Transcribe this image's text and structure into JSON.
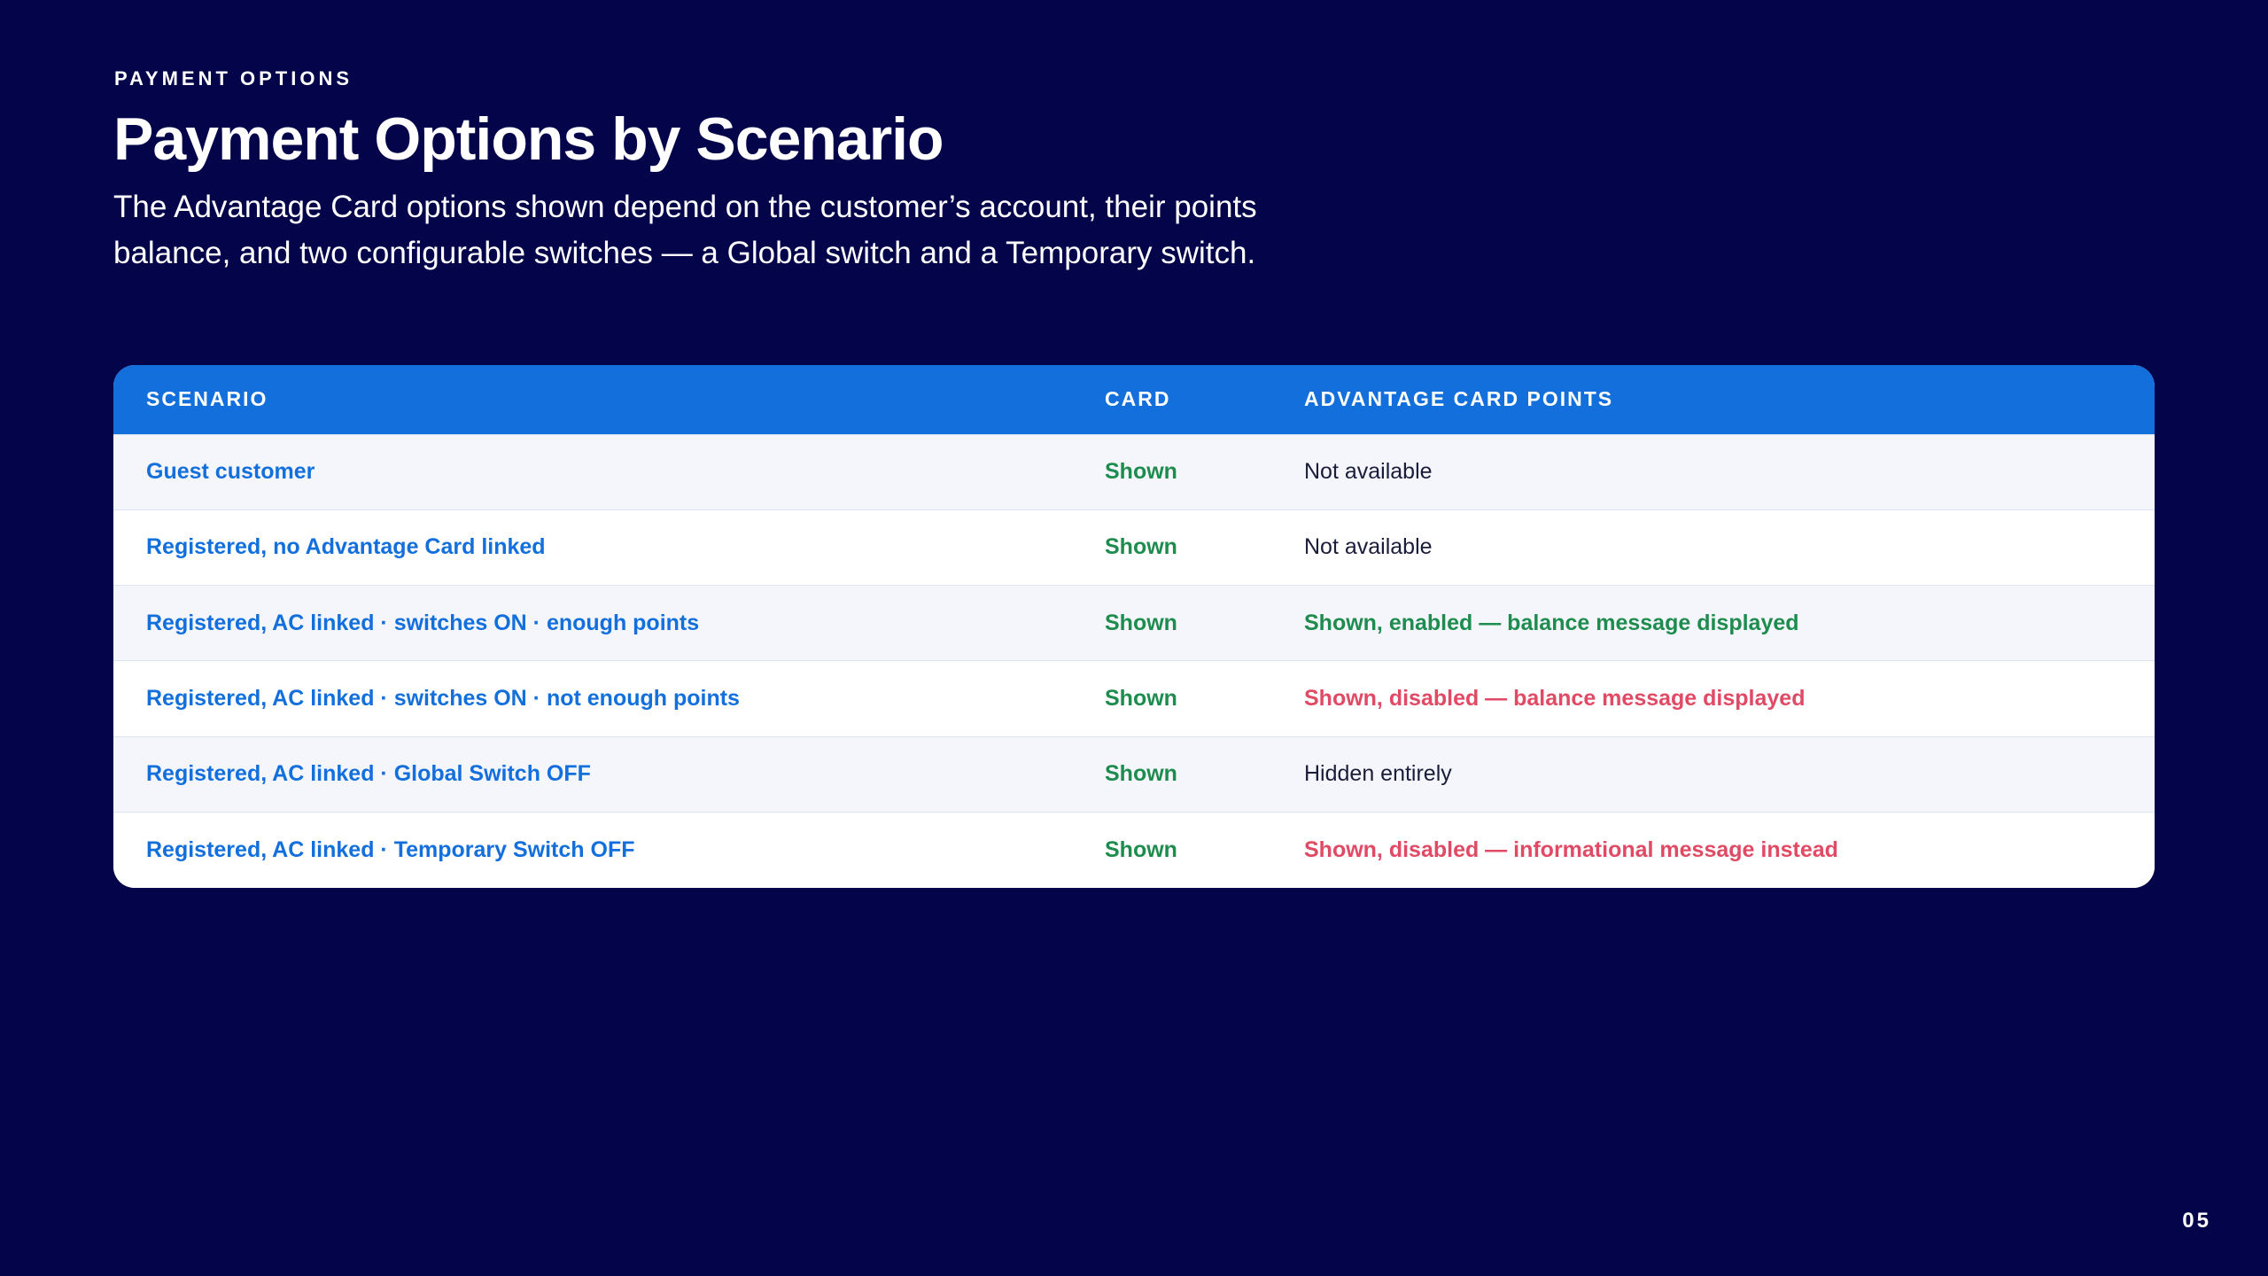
{
  "header": {
    "eyebrow": "PAYMENT OPTIONS",
    "title": "Payment Options by Scenario",
    "subtitle": "The Advantage Card options shown depend on the customer’s account, their points balance, and two configurable switches — a Global switch and a Temporary switch."
  },
  "table": {
    "columns": [
      "SCENARIO",
      "CARD",
      "ADVANTAGE CARD POINTS"
    ],
    "rows": [
      {
        "scenario": "Guest customer",
        "card": "Shown",
        "points": "Not available",
        "points_status": "neutral"
      },
      {
        "scenario": "Registered, no Advantage Card linked",
        "card": "Shown",
        "points": "Not available",
        "points_status": "neutral"
      },
      {
        "scenario": "Registered, AC linked · switches ON · enough points",
        "card": "Shown",
        "points": "Shown, enabled — balance message displayed",
        "points_status": "positive"
      },
      {
        "scenario": "Registered, AC linked · switches ON · not enough points",
        "card": "Shown",
        "points": "Shown, disabled — balance message displayed",
        "points_status": "negative"
      },
      {
        "scenario": "Registered, AC linked · Global Switch OFF",
        "card": "Shown",
        "points": "Hidden entirely",
        "points_status": "neutral"
      },
      {
        "scenario": "Registered, AC linked · Temporary Switch OFF",
        "card": "Shown",
        "points": "Shown, disabled — informational message instead",
        "points_status": "negative"
      }
    ]
  },
  "footer": {
    "page_number": "05"
  },
  "colors": {
    "background": "#03044a",
    "header_blue": "#126fdc",
    "positive_green": "#1e8c4e",
    "negative_red": "#e04a64",
    "neutral_text": "#1a1d3a"
  }
}
